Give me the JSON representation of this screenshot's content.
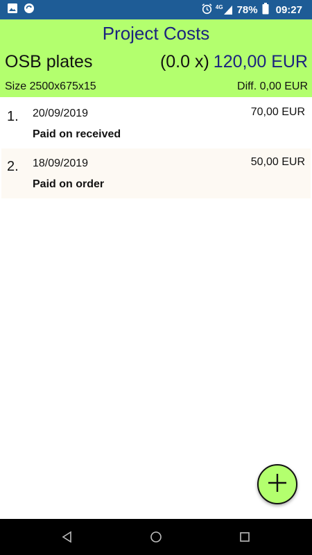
{
  "status_bar": {
    "icons_left": [
      "image-icon",
      "sync-icon"
    ],
    "icons_right": [
      "alarm-icon",
      "signal-4g-icon",
      "battery-icon"
    ],
    "network": "4G",
    "battery": "78%",
    "time": "09:27"
  },
  "header": {
    "title": "Project Costs",
    "item_name": "OSB plates",
    "quantity": "(0.0 x)",
    "total": "120,00 EUR",
    "size": "Size 2500x675x15",
    "diff": "Diff. 0,00 EUR"
  },
  "payments": [
    {
      "number": "1.",
      "date": "20/09/2019",
      "status": "Paid on received",
      "amount": "70,00 EUR"
    },
    {
      "number": "2.",
      "date": "18/09/2019",
      "status": "Paid on order",
      "amount": "50,00 EUR"
    }
  ],
  "fab": {
    "icon": "plus-icon"
  },
  "nav_bar": {
    "icons": [
      "back-icon",
      "home-icon",
      "recents-icon"
    ]
  },
  "colors": {
    "status_bar": "#1e5c96",
    "header_bg": "#b3ff6e",
    "title": "#1a237e",
    "total": "#1a237e",
    "alt_row": "#fdf9f3",
    "nav_bar": "#000000"
  }
}
